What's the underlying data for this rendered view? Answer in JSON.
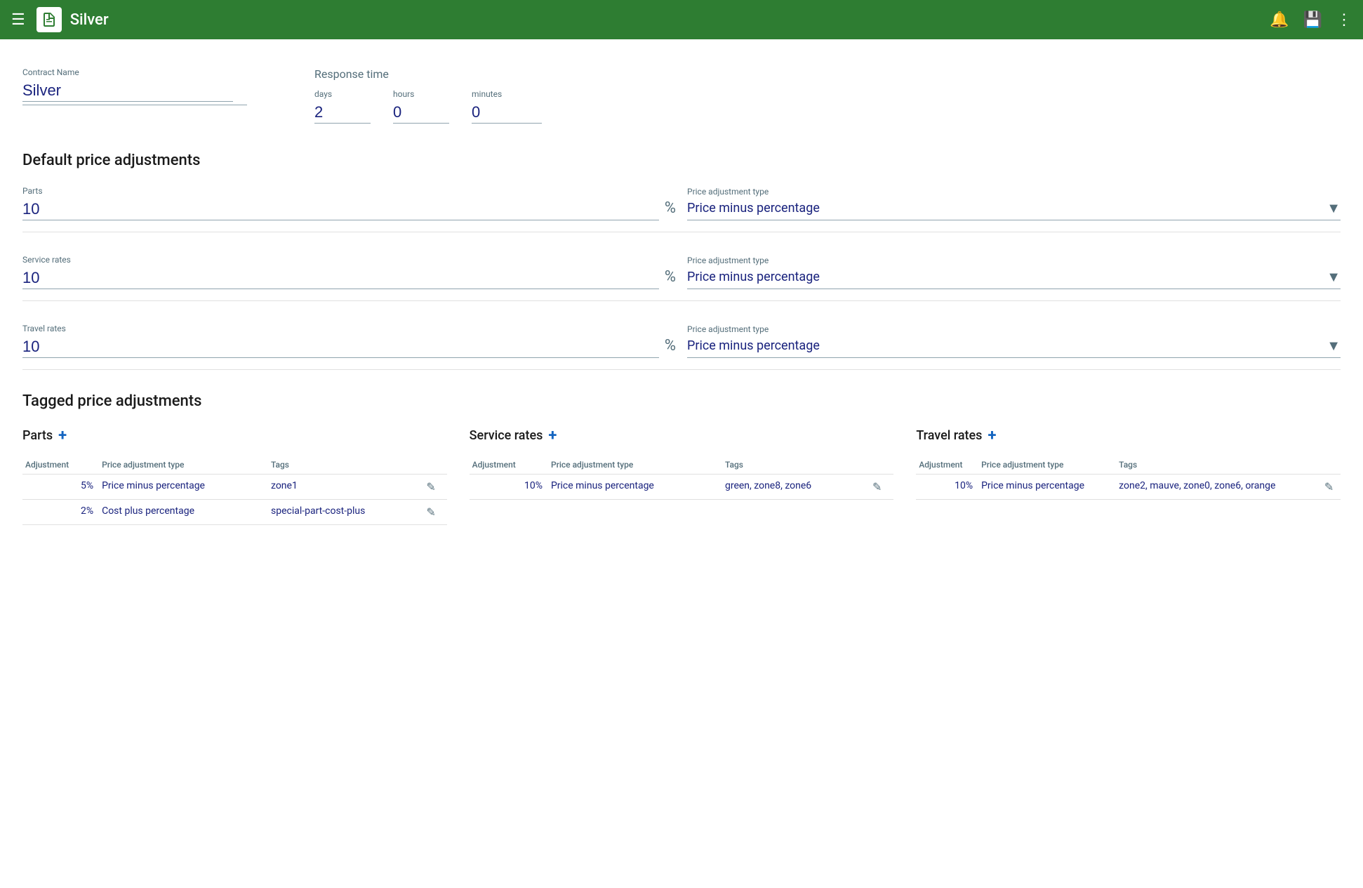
{
  "header": {
    "title": "Silver",
    "menu_label": "menu",
    "bell_label": "notifications",
    "save_label": "save",
    "more_label": "more options"
  },
  "contract": {
    "name_label": "Contract Name",
    "name_value": "Silver",
    "response_time_label": "Response time",
    "days_label": "days",
    "days_value": "2",
    "hours_label": "hours",
    "hours_value": "0",
    "minutes_label": "minutes",
    "minutes_value": "0"
  },
  "default_adjustments": {
    "section_title": "Default price adjustments",
    "parts": {
      "label": "Parts",
      "value": "10",
      "price_adj_label": "Price adjustment type",
      "price_adj_value": "Price minus percentage"
    },
    "service_rates": {
      "label": "Service rates",
      "value": "10",
      "price_adj_label": "Price adjustment type",
      "price_adj_value": "Price minus percentage"
    },
    "travel_rates": {
      "label": "Travel rates",
      "value": "10",
      "price_adj_label": "Price adjustment type",
      "price_adj_value": "Price minus percentage"
    }
  },
  "tagged_adjustments": {
    "section_title": "Tagged price adjustments",
    "parts": {
      "title": "Parts",
      "add_icon": "+",
      "columns": [
        "Adjustment",
        "Price adjustment type",
        "Tags"
      ],
      "rows": [
        {
          "adjustment": "5%",
          "type": "Price minus percentage",
          "tags": "zone1"
        },
        {
          "adjustment": "2%",
          "type": "Cost plus percentage",
          "tags": "special-part-cost-plus"
        }
      ]
    },
    "service_rates": {
      "title": "Service rates",
      "add_icon": "+",
      "columns": [
        "Adjustment",
        "Price adjustment type",
        "Tags"
      ],
      "rows": [
        {
          "adjustment": "10%",
          "type": "Price minus percentage",
          "tags": "green, zone8, zone6"
        }
      ]
    },
    "travel_rates": {
      "title": "Travel rates",
      "add_icon": "+",
      "columns": [
        "Adjustment",
        "Price adjustment type",
        "Tags"
      ],
      "rows": [
        {
          "adjustment": "10%",
          "type": "Price minus percentage",
          "tags": "zone2, mauve, zone0, zone6, orange"
        }
      ]
    }
  }
}
